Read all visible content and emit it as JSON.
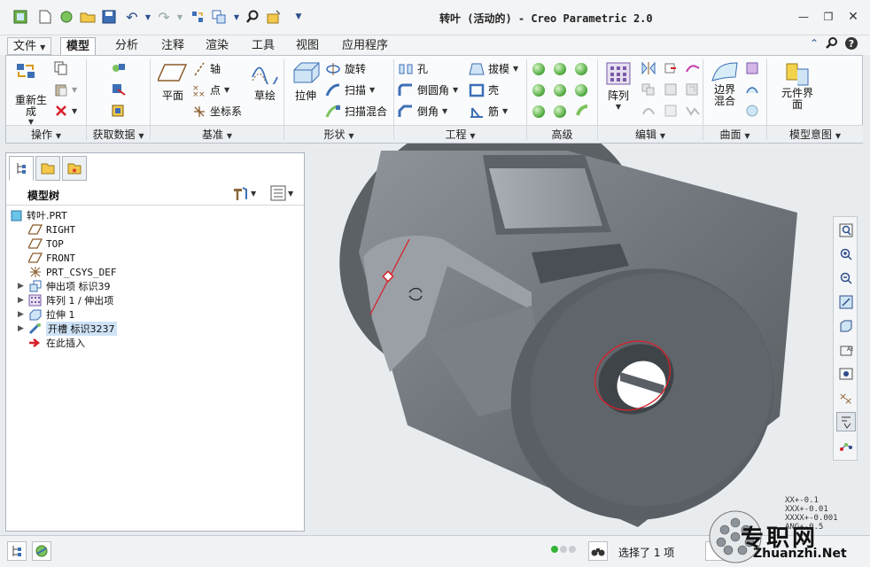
{
  "window": {
    "title": "转叶 (活动的) - Creo Parametric 2.0"
  },
  "ribbon": {
    "tabs": [
      "文件",
      "模型",
      "分析",
      "注释",
      "渲染",
      "工具",
      "视图",
      "应用程序"
    ],
    "active_tab": "模型",
    "groups": [
      "操作",
      "获取数据",
      "基准",
      "形状",
      "工程",
      "高级",
      "编辑",
      "曲面",
      "模型意图"
    ],
    "operations": {
      "regenerate": "重新生成"
    },
    "datum": {
      "plane": "平面",
      "axis": "轴",
      "point": "点",
      "csys": "坐标系",
      "sketch": "草绘"
    },
    "shape": {
      "extrude": "拉伸",
      "revolve": "旋转",
      "sweep": "扫描",
      "swept_blend": "扫描混合"
    },
    "engineering": {
      "hole": "孔",
      "round": "倒圆角",
      "chamfer": "倒角",
      "draft": "拔模",
      "shell": "壳",
      "rib": "筋"
    },
    "editing": {
      "pattern": "阵列"
    },
    "surfaces": {
      "boundary_blend": "边界混合"
    },
    "model_intent": {
      "component_interface": "元件界面"
    }
  },
  "model_tree": {
    "title": "模型树",
    "items": [
      {
        "label": "转叶.PRT"
      },
      {
        "label": "RIGHT"
      },
      {
        "label": "TOP"
      },
      {
        "label": "FRONT"
      },
      {
        "label": "PRT_CSYS_DEF"
      },
      {
        "label": "伸出项 标识39"
      },
      {
        "label": "阵列 1 / 伸出项"
      },
      {
        "label": "拉伸 1"
      },
      {
        "label": "开槽 标识3237"
      },
      {
        "label": "在此插入"
      }
    ]
  },
  "tolerance": [
    "XX+-0.1",
    "XXX+-0.01",
    "XXXX+-0.001",
    "ANG+-0.5"
  ],
  "status": {
    "selection": "选择了 1 项"
  },
  "watermark": {
    "main": "专职网",
    "sub": "Zhuanzhi.Net"
  },
  "colors": {
    "accent": "#2c4e8a",
    "model": "#6b7178",
    "model_dark": "#4a4f55",
    "highlight": "#d8202a"
  }
}
